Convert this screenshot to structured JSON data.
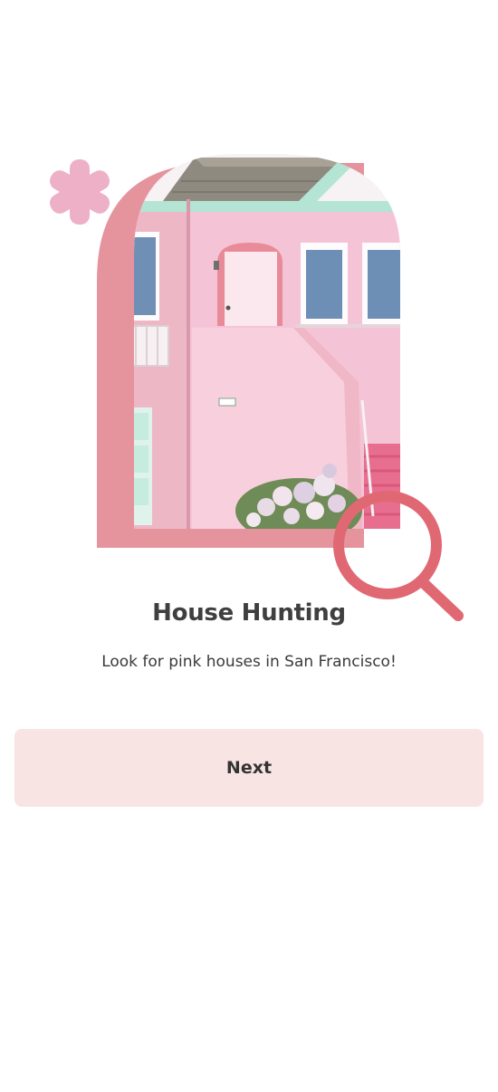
{
  "onboarding": {
    "title": "House Hunting",
    "subtitle": "Look for pink houses in San Francisco!",
    "next_label": "Next"
  },
  "icons": {
    "decoration": "asterisk-flower-icon",
    "search": "magnifying-glass-icon"
  },
  "colors": {
    "arch_pink": "#e5949e",
    "house_pink": "#f4c4d6",
    "magnifier": "#e06872",
    "asterisk": "#eeb0c6",
    "button_bg": "#f9e4e4",
    "title_text": "#3f3f3f"
  }
}
